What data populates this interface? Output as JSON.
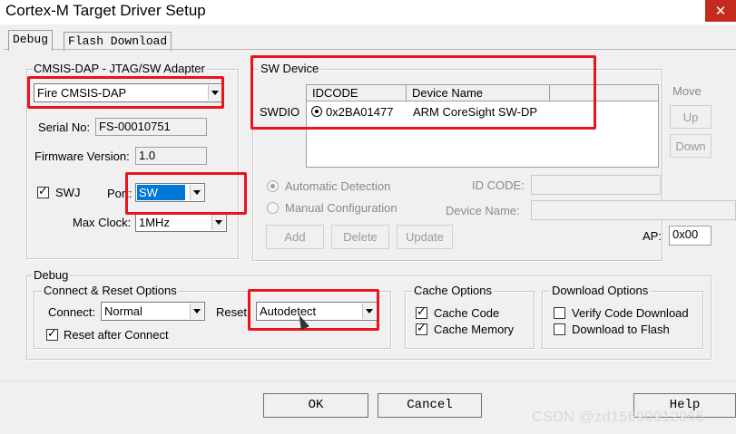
{
  "window": {
    "title": "Cortex-M Target Driver Setup",
    "close_glyph": "✕"
  },
  "tabs": [
    {
      "label": "Debug"
    },
    {
      "label": "Flash Download"
    }
  ],
  "adapter": {
    "legend": "CMSIS-DAP - JTAG/SW Adapter",
    "selected": "Fire CMSIS-DAP",
    "serial_label": "Serial No:",
    "serial_value": "FS-00010751",
    "firmware_label": "Firmware Version:",
    "firmware_value": "1.0",
    "swj_label": "SWJ",
    "swj_checked": true,
    "port_label": "Port:",
    "port_value": "SW",
    "clock_label": "Max Clock:",
    "clock_value": "1MHz"
  },
  "sw_device": {
    "legend": "SW Device",
    "columns": [
      "IDCODE",
      "Device Name"
    ],
    "row_label": "SWDIO",
    "rows": [
      {
        "idcode": "0x2BA01477",
        "device": "ARM CoreSight SW-DP"
      }
    ],
    "move_label": "Move",
    "up_label": "Up",
    "down_label": "Down",
    "auto_label": "Automatic Detection",
    "manual_label": "Manual Configuration",
    "idcode_label": "ID CODE:",
    "devname_label": "Device Name:",
    "add_label": "Add",
    "delete_label": "Delete",
    "update_label": "Update",
    "ap_label": "AP:",
    "ap_value": "0x00"
  },
  "debug": {
    "legend": "Debug",
    "connect_reset": {
      "legend": "Connect & Reset Options",
      "connect_label": "Connect:",
      "connect_value": "Normal",
      "reset_label": "Reset:",
      "reset_value": "Autodetect",
      "reset_after_label": "Reset after Connect",
      "reset_after_checked": true
    },
    "cache": {
      "legend": "Cache Options",
      "code_label": "Cache Code",
      "code_checked": true,
      "memory_label": "Cache Memory",
      "memory_checked": true
    },
    "download": {
      "legend": "Download Options",
      "verify_label": "Verify Code Download",
      "verify_checked": false,
      "flash_label": "Download to Flash",
      "flash_checked": false
    }
  },
  "footer": {
    "ok_label": "OK",
    "cancel_label": "Cancel",
    "help_label": "Help"
  },
  "watermark": "CSDN @zd15690912965",
  "colors": {
    "highlight": "#e8141c",
    "selection": "#0078d7",
    "close": "#c42b1c"
  }
}
